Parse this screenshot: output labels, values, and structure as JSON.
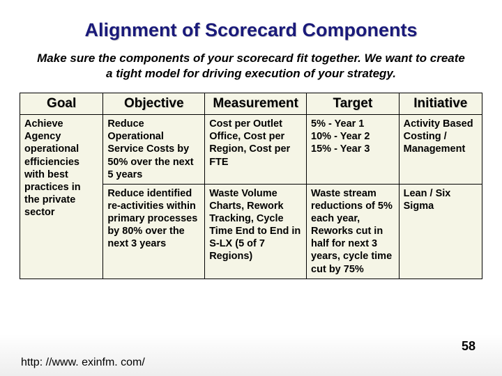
{
  "title": "Alignment of Scorecard Components",
  "subtitle": "Make sure the components of your scorecard fit together. We want to create a tight model for driving execution of your strategy.",
  "headers": {
    "goal": "Goal",
    "objective": "Objective",
    "measurement": "Measurement",
    "target": "Target",
    "initiative": "Initiative"
  },
  "rows": [
    {
      "goal": "Achieve Agency operational efficiencies with best practices in the private sector",
      "objective": "Reduce Operational Service Costs by 50% over the next 5 years",
      "measurement": "Cost per Outlet Office, Cost per Region, Cost per FTE",
      "target": "5% - Year 1\n10% - Year 2\n15% - Year 3",
      "initiative": "Activity Based Costing / Management"
    },
    {
      "goal": "",
      "objective": "Reduce identified re-activities within primary processes by 80% over the next 3 years",
      "measurement": " Waste Volume Charts, Rework Tracking, Cycle Time End to End in S-LX (5 of 7 Regions)",
      "target": "Waste stream reductions of 5% each year, Reworks cut in half for next 3 years, cycle time cut by 75%",
      "initiative": "Lean / Six Sigma"
    }
  ],
  "footer_url": "http: //www. exinfm. com/",
  "page_number": "58"
}
